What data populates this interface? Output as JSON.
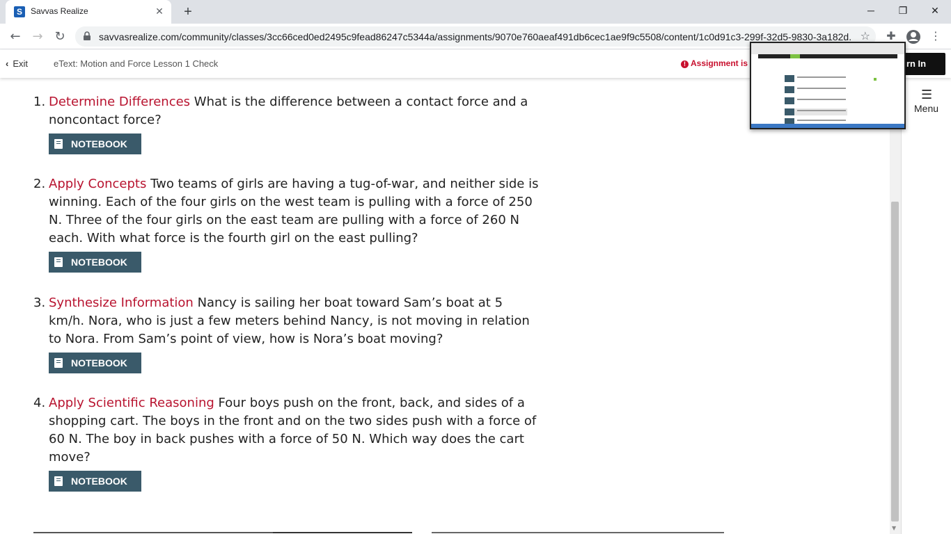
{
  "browser": {
    "tab_title": "Savvas Realize",
    "tab_favicon_letter": "S",
    "tab_close": "✕",
    "new_tab": "+",
    "url": "savvasrealize.com/community/classes/3cc66ced0ed2495c9fead86247c5344a/assignments/9070e760aeaf491db6cec1ae9f9c5508/content/1c0d91c3-299f-32d5-9830-3a182d...",
    "window_controls": {
      "minimize": "─",
      "restore": "❐",
      "close": "✕"
    }
  },
  "header": {
    "exit_label": "Exit",
    "lesson_title": "eText: Motion and Force Lesson 1 Check",
    "assignment_status": "Assignment is",
    "turn_in_label": "urn In"
  },
  "menu": {
    "label": "Menu"
  },
  "questions": [
    {
      "number": "1.",
      "skill": "Determine Differences",
      "text": " What is the difference between a contact force and a noncontact force?",
      "notebook_label": "NOTEBOOK"
    },
    {
      "number": "2.",
      "skill": "Apply Concepts",
      "text": " Two teams of girls are having a tug-of-war, and neither side is winning. Each of the four girls on the west team is pulling with a force of 250 N. Three of the four girls on the east team are pulling with a force of 260 N each. With what force is the fourth girl on the east pulling?",
      "notebook_label": "NOTEBOOK"
    },
    {
      "number": "3.",
      "skill": "Synthesize Information",
      "text": " Nancy is sailing her boat toward Sam’s boat at 5 km/h. Nora, who is just a few meters behind Nancy, is not moving in relation to Nora. From Sam’s point of view, how is Nora’s boat moving?",
      "notebook_label": "NOTEBOOK"
    },
    {
      "number": "4.",
      "skill": "Apply Scientific Reasoning",
      "text": " Four boys push on the front, back, and sides of a shopping cart. The boys in the front and on the two sides push with a force of 60 N. The boy in back pushes with a force of 50 N. Which way does the cart move?",
      "notebook_label": "NOTEBOOK"
    }
  ],
  "colors": {
    "skill_red": "#b8132f",
    "notebook_bg": "#3a5a6a",
    "status_red": "#c8102e"
  }
}
